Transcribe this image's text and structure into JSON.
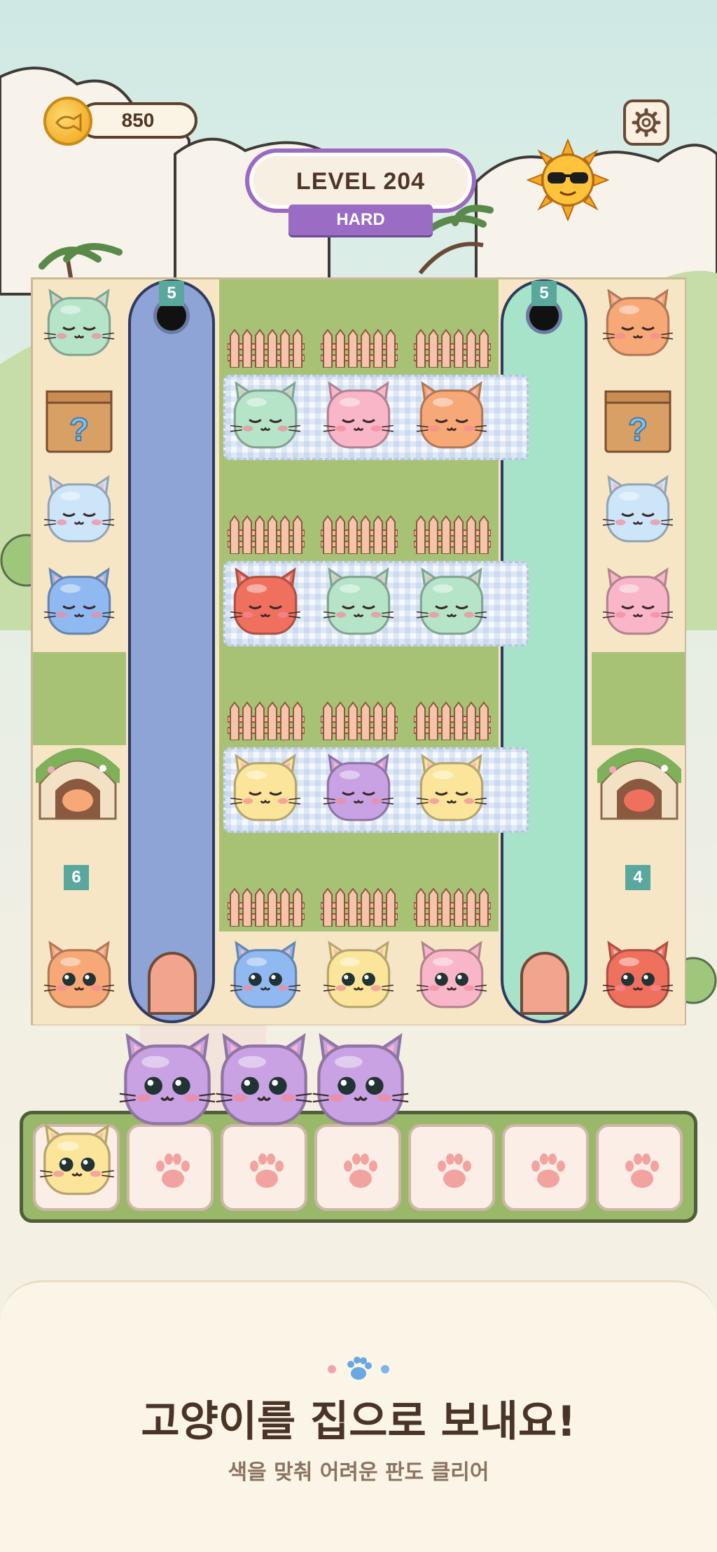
{
  "header": {
    "coins": "850",
    "level_title": "LEVEL 204",
    "difficulty": "HARD"
  },
  "board": {
    "left_tube_count": "5",
    "right_tube_count": "5",
    "left_house_count": "6",
    "right_house_count": "4",
    "cat_colors": {
      "green": "#b5e4c8",
      "pink": "#f8b6c8",
      "orange": "#f6a877",
      "lightblue": "#cde5f8",
      "blue": "#8fb9f0",
      "red": "#f0705e",
      "yellow": "#fbe59a",
      "purple": "#c8a2e3"
    },
    "tube_colors": {
      "left": "#8ea3d6",
      "right": "#a6e3c9"
    }
  },
  "tray": {
    "slot_count": 7,
    "cats_in_tray": [
      "yellow"
    ],
    "cats_incoming": [
      "purple",
      "purple",
      "purple"
    ]
  },
  "footer": {
    "headline": "고양이를 집으로 보내요!",
    "subline": "색을 맞춰 어려운 판도 클리어"
  }
}
